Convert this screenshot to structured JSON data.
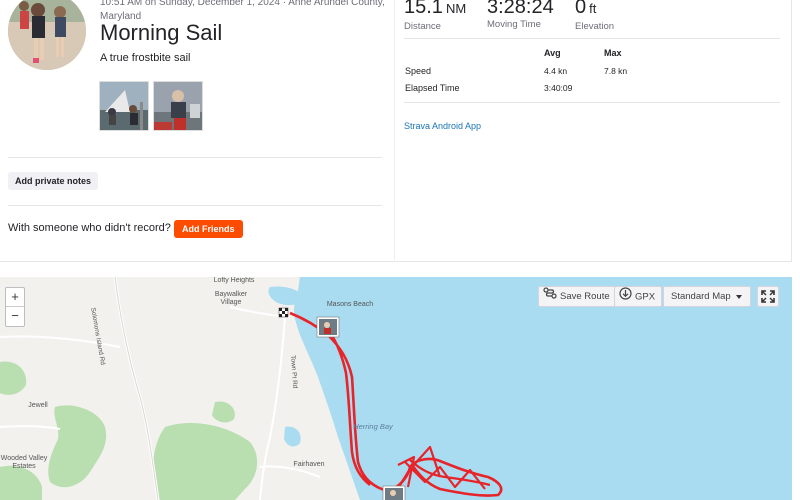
{
  "activity": {
    "meta_line": "10:51 AM on Sunday, December 1, 2024 · Anne Arundel County, Maryland",
    "title": "Morning Sail",
    "description": "A true frostbite sail",
    "private_notes_button": "Add private notes",
    "friends_prompt": "With someone who didn't record?",
    "add_friends_button": "Add Friends",
    "accent_color": "#fc4c02"
  },
  "stats": {
    "distance": {
      "value": "15.1",
      "unit": "NM",
      "label": "Distance"
    },
    "moving_time": {
      "value": "3:28:24",
      "label": "Moving Time"
    },
    "elevation": {
      "value": "0",
      "unit": "ft",
      "label": "Elevation"
    },
    "table": {
      "headers": [
        "Avg",
        "Max"
      ],
      "rows": [
        {
          "label": "Speed",
          "avg": "4.4 kn",
          "max": "7.8 kn"
        },
        {
          "label": "Elapsed Time",
          "avg": "3:40:09",
          "max": ""
        }
      ]
    },
    "device_link": "Strava Android App"
  },
  "map": {
    "controls": {
      "zoom_in": "+",
      "zoom_out": "−",
      "save_route": "Save Route",
      "gpx": "GPX",
      "map_style": "Standard Map"
    },
    "labels": {
      "lofty_heights": "Lofty Heights",
      "baywalker_village": "Baywalker Village",
      "masons_beach": "Masons Beach",
      "solomons_island_rd": "Solomons Island Rd",
      "town_pt_rd": "Town Pt Rd",
      "jewell": "Jewell",
      "herring_bay": "Herring Bay",
      "wooded_valley_estates": "Wooded Valley Estates",
      "fairhaven": "Fairhaven"
    },
    "colors": {
      "water": "#a9dcf0",
      "land": "#f2f1ed",
      "park": "#b9dfb0",
      "track": "#e8242b"
    },
    "icons": [
      "plus-icon",
      "minus-icon",
      "save-route-icon",
      "download-icon",
      "chevron-down-icon",
      "fullscreen-icon",
      "start-flag-icon",
      "photo-marker-icon"
    ]
  }
}
